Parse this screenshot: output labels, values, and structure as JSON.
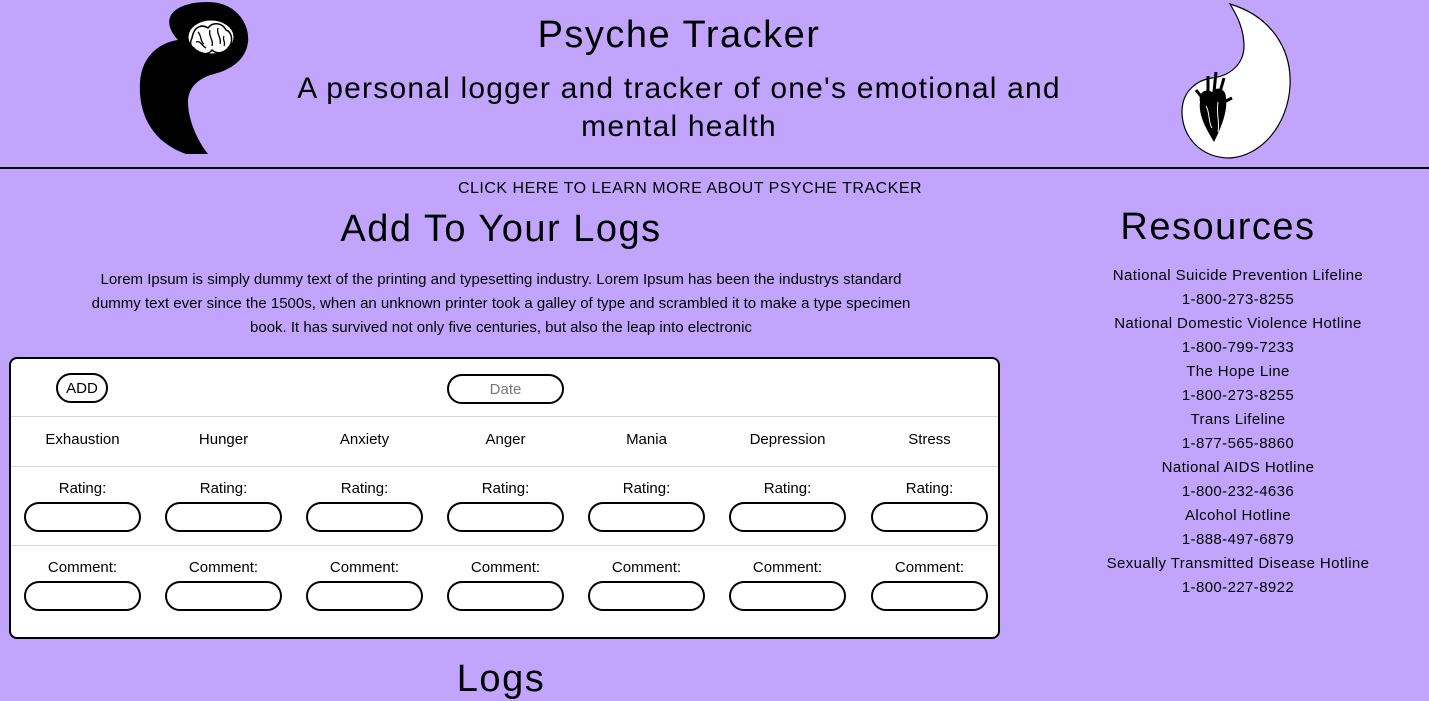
{
  "header": {
    "title": "Psyche Tracker",
    "subtitle": "A personal logger and tracker of one's emotional and mental health"
  },
  "learn_more_label": "CLICK HERE TO LEARN MORE ABOUT PSYCHE TRACKER",
  "add_section": {
    "title": "Add To Your Logs",
    "description": "Lorem Ipsum is simply dummy text of the printing and typesetting industry. Lorem Ipsum has been the industrys standard dummy text ever since the 1500s, when an unknown printer took a galley of type and scrambled it to make a type specimen book. It has survived not only five centuries, but also the leap into electronic"
  },
  "logger": {
    "add_label": "ADD",
    "date_placeholder": "Date",
    "rating_label": "Rating:",
    "comment_label": "Comment:",
    "categories": [
      "Exhaustion",
      "Hunger",
      "Anxiety",
      "Anger",
      "Mania",
      "Depression",
      "Stress"
    ]
  },
  "resources": {
    "title": "Resources",
    "items": [
      {
        "name": "National Suicide Prevention Lifeline",
        "phone": "1-800-273-8255"
      },
      {
        "name": "National Domestic Violence Hotline",
        "phone": "1-800-799-7233"
      },
      {
        "name": "The Hope Line",
        "phone": "1-800-273-8255"
      },
      {
        "name": "Trans Lifeline",
        "phone": "1-877-565-8860"
      },
      {
        "name": "National AIDS Hotline",
        "phone": "1-800-232-4636"
      },
      {
        "name": "Alcohol Hotline",
        "phone": "1-888-497-6879"
      },
      {
        "name": "Sexually Transmitted Disease Hotline",
        "phone": "1-800-227-8922"
      }
    ]
  },
  "logs_title": "Logs",
  "colors": {
    "background": "#c1a5fd",
    "panel": "#ffffff",
    "ink": "#000000"
  },
  "icons": {
    "left_logo": "yin-brain-icon",
    "right_logo": "yang-heart-icon"
  }
}
